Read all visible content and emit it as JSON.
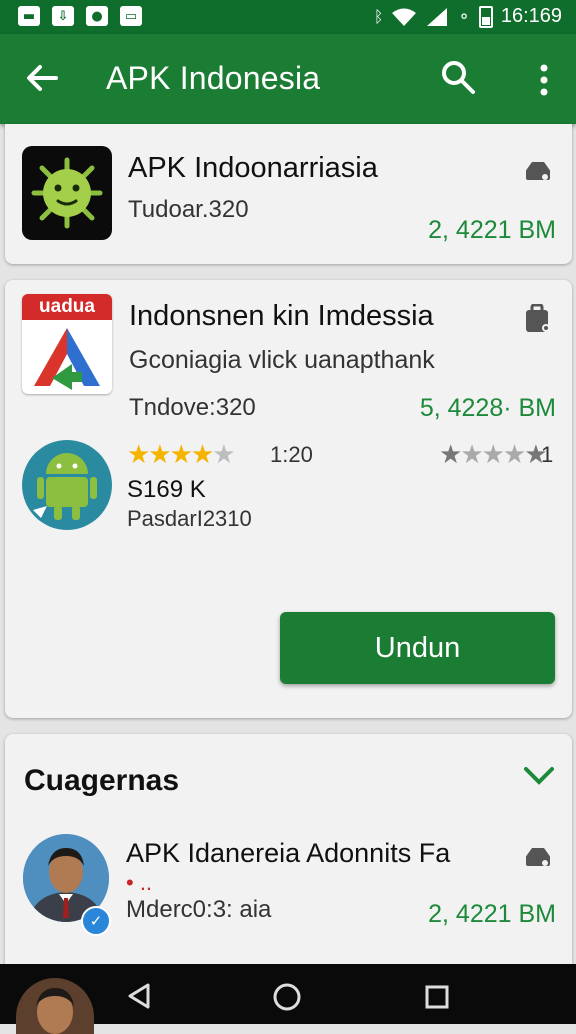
{
  "status_bar": {
    "time": "16:169",
    "icons": [
      "photo-icon",
      "download-icon",
      "circle-icon",
      "chat-icon",
      "bluetooth-icon",
      "wifi-icon",
      "signal-icon",
      "battery-icon"
    ]
  },
  "app_bar": {
    "title": "APK Indonesia",
    "icons": [
      "back-arrow-icon",
      "search-icon",
      "more-vert-icon"
    ]
  },
  "card1": {
    "title": "APK Indoonarriasia",
    "version": "Tudoar.320",
    "size": "2, 4221 BM",
    "icon": "android-bug-icon"
  },
  "card2": {
    "title": "Indonsnen kin Imdessia",
    "subtitle": "Gconiagia vlick uanapthank",
    "version": "Tndove:320",
    "size": "5, 4228· BM",
    "badge_text": "uadua",
    "rating_value": "1:20",
    "downloads": "S169 K",
    "publisher": "PasdarI2310",
    "right_rating_count": "1",
    "install_button": "Undun",
    "accent": "#1b7c34"
  },
  "card3": {
    "header": "Cuagernas",
    "item": {
      "title": "APK Idanereia Adonnits Fa",
      "dots": "•  ..",
      "version": "Mderc0:3: aia",
      "size": "2, 4221 BM"
    }
  },
  "nav_bar": {
    "icons": [
      "back-triangle-icon",
      "home-circle-icon",
      "recents-square-icon"
    ]
  }
}
